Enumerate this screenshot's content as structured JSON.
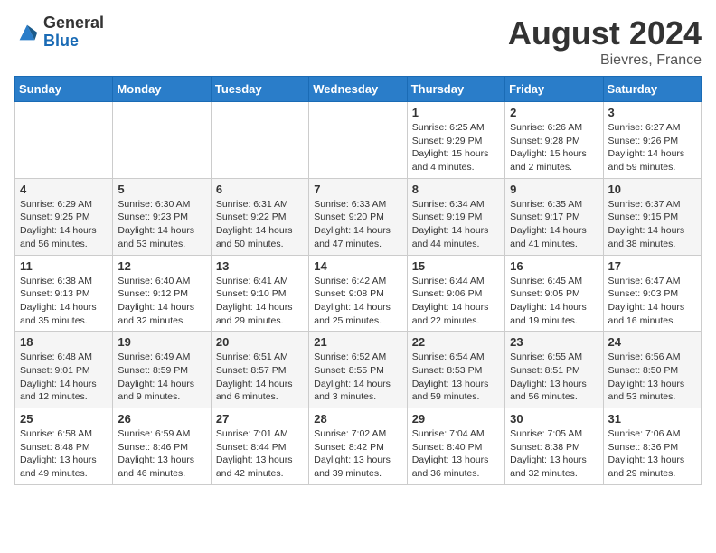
{
  "header": {
    "logo_general": "General",
    "logo_blue": "Blue",
    "month_year": "August 2024",
    "location": "Bievres, France"
  },
  "days_of_week": [
    "Sunday",
    "Monday",
    "Tuesday",
    "Wednesday",
    "Thursday",
    "Friday",
    "Saturday"
  ],
  "weeks": [
    [
      {
        "day": "",
        "info": ""
      },
      {
        "day": "",
        "info": ""
      },
      {
        "day": "",
        "info": ""
      },
      {
        "day": "",
        "info": ""
      },
      {
        "day": "1",
        "info": "Sunrise: 6:25 AM\nSunset: 9:29 PM\nDaylight: 15 hours\nand 4 minutes."
      },
      {
        "day": "2",
        "info": "Sunrise: 6:26 AM\nSunset: 9:28 PM\nDaylight: 15 hours\nand 2 minutes."
      },
      {
        "day": "3",
        "info": "Sunrise: 6:27 AM\nSunset: 9:26 PM\nDaylight: 14 hours\nand 59 minutes."
      }
    ],
    [
      {
        "day": "4",
        "info": "Sunrise: 6:29 AM\nSunset: 9:25 PM\nDaylight: 14 hours\nand 56 minutes."
      },
      {
        "day": "5",
        "info": "Sunrise: 6:30 AM\nSunset: 9:23 PM\nDaylight: 14 hours\nand 53 minutes."
      },
      {
        "day": "6",
        "info": "Sunrise: 6:31 AM\nSunset: 9:22 PM\nDaylight: 14 hours\nand 50 minutes."
      },
      {
        "day": "7",
        "info": "Sunrise: 6:33 AM\nSunset: 9:20 PM\nDaylight: 14 hours\nand 47 minutes."
      },
      {
        "day": "8",
        "info": "Sunrise: 6:34 AM\nSunset: 9:19 PM\nDaylight: 14 hours\nand 44 minutes."
      },
      {
        "day": "9",
        "info": "Sunrise: 6:35 AM\nSunset: 9:17 PM\nDaylight: 14 hours\nand 41 minutes."
      },
      {
        "day": "10",
        "info": "Sunrise: 6:37 AM\nSunset: 9:15 PM\nDaylight: 14 hours\nand 38 minutes."
      }
    ],
    [
      {
        "day": "11",
        "info": "Sunrise: 6:38 AM\nSunset: 9:13 PM\nDaylight: 14 hours\nand 35 minutes."
      },
      {
        "day": "12",
        "info": "Sunrise: 6:40 AM\nSunset: 9:12 PM\nDaylight: 14 hours\nand 32 minutes."
      },
      {
        "day": "13",
        "info": "Sunrise: 6:41 AM\nSunset: 9:10 PM\nDaylight: 14 hours\nand 29 minutes."
      },
      {
        "day": "14",
        "info": "Sunrise: 6:42 AM\nSunset: 9:08 PM\nDaylight: 14 hours\nand 25 minutes."
      },
      {
        "day": "15",
        "info": "Sunrise: 6:44 AM\nSunset: 9:06 PM\nDaylight: 14 hours\nand 22 minutes."
      },
      {
        "day": "16",
        "info": "Sunrise: 6:45 AM\nSunset: 9:05 PM\nDaylight: 14 hours\nand 19 minutes."
      },
      {
        "day": "17",
        "info": "Sunrise: 6:47 AM\nSunset: 9:03 PM\nDaylight: 14 hours\nand 16 minutes."
      }
    ],
    [
      {
        "day": "18",
        "info": "Sunrise: 6:48 AM\nSunset: 9:01 PM\nDaylight: 14 hours\nand 12 minutes."
      },
      {
        "day": "19",
        "info": "Sunrise: 6:49 AM\nSunset: 8:59 PM\nDaylight: 14 hours\nand 9 minutes."
      },
      {
        "day": "20",
        "info": "Sunrise: 6:51 AM\nSunset: 8:57 PM\nDaylight: 14 hours\nand 6 minutes."
      },
      {
        "day": "21",
        "info": "Sunrise: 6:52 AM\nSunset: 8:55 PM\nDaylight: 14 hours\nand 3 minutes."
      },
      {
        "day": "22",
        "info": "Sunrise: 6:54 AM\nSunset: 8:53 PM\nDaylight: 13 hours\nand 59 minutes."
      },
      {
        "day": "23",
        "info": "Sunrise: 6:55 AM\nSunset: 8:51 PM\nDaylight: 13 hours\nand 56 minutes."
      },
      {
        "day": "24",
        "info": "Sunrise: 6:56 AM\nSunset: 8:50 PM\nDaylight: 13 hours\nand 53 minutes."
      }
    ],
    [
      {
        "day": "25",
        "info": "Sunrise: 6:58 AM\nSunset: 8:48 PM\nDaylight: 13 hours\nand 49 minutes."
      },
      {
        "day": "26",
        "info": "Sunrise: 6:59 AM\nSunset: 8:46 PM\nDaylight: 13 hours\nand 46 minutes."
      },
      {
        "day": "27",
        "info": "Sunrise: 7:01 AM\nSunset: 8:44 PM\nDaylight: 13 hours\nand 42 minutes."
      },
      {
        "day": "28",
        "info": "Sunrise: 7:02 AM\nSunset: 8:42 PM\nDaylight: 13 hours\nand 39 minutes."
      },
      {
        "day": "29",
        "info": "Sunrise: 7:04 AM\nSunset: 8:40 PM\nDaylight: 13 hours\nand 36 minutes."
      },
      {
        "day": "30",
        "info": "Sunrise: 7:05 AM\nSunset: 8:38 PM\nDaylight: 13 hours\nand 32 minutes."
      },
      {
        "day": "31",
        "info": "Sunrise: 7:06 AM\nSunset: 8:36 PM\nDaylight: 13 hours\nand 29 minutes."
      }
    ]
  ]
}
